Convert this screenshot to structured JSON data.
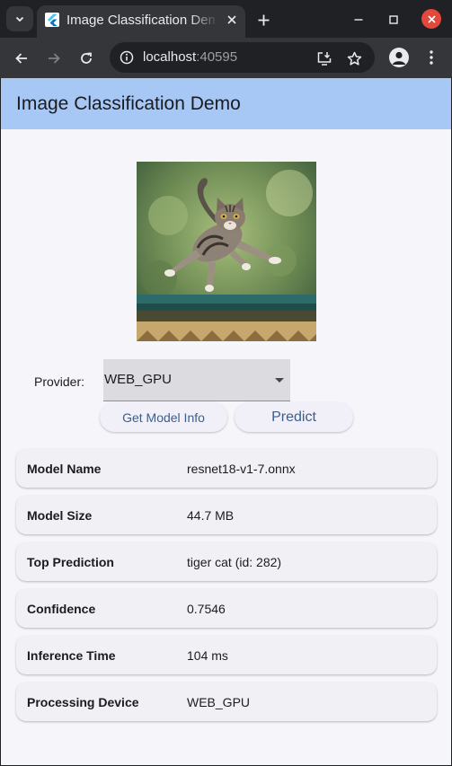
{
  "browser": {
    "tab_title": "Image Classification Demo",
    "url_host": "localhost",
    "url_port": ":40595"
  },
  "app": {
    "title": "Image Classification Demo",
    "provider_label": "Provider:",
    "provider_value": "WEB_GPU",
    "get_model_info_label": "Get Model Info",
    "predict_label": "Predict"
  },
  "results": [
    {
      "label": "Model Name",
      "value": "resnet18-v1-7.onnx"
    },
    {
      "label": "Model Size",
      "value": "44.7 MB"
    },
    {
      "label": "Top Prediction",
      "value": "tiger cat (id: 282)"
    },
    {
      "label": "Confidence",
      "value": "0.7546"
    },
    {
      "label": "Inference Time",
      "value": "104 ms"
    },
    {
      "label": "Processing Device",
      "value": "WEB_GPU"
    }
  ],
  "colors": {
    "app_bar": "#a7c8f5",
    "page_background": "#f6f5fa",
    "button_text": "#3e5d8c",
    "close_button": "#e2483b"
  }
}
